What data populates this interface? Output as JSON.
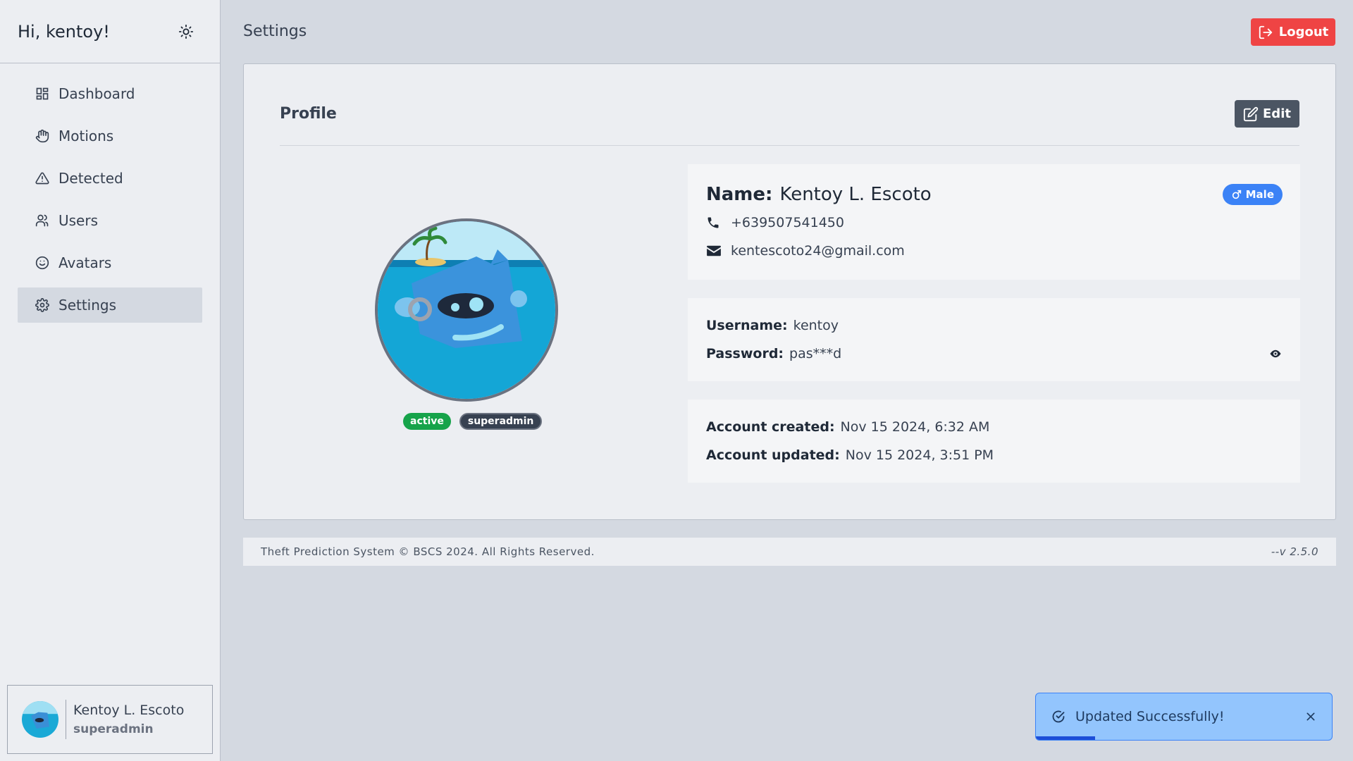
{
  "sidebar": {
    "greeting": "Hi, kentoy!",
    "items": [
      {
        "label": "Dashboard",
        "icon": "dashboard-icon"
      },
      {
        "label": "Motions",
        "icon": "hand-icon"
      },
      {
        "label": "Detected",
        "icon": "warning-icon"
      },
      {
        "label": "Users",
        "icon": "users-icon"
      },
      {
        "label": "Avatars",
        "icon": "smiley-icon"
      },
      {
        "label": "Settings",
        "icon": "gear-icon"
      }
    ],
    "active": "Settings",
    "user": {
      "name": "Kentoy L. Escoto",
      "role": "superadmin"
    }
  },
  "header": {
    "title": "Settings",
    "logout_label": "Logout"
  },
  "profile": {
    "title": "Profile",
    "edit_label": "Edit",
    "badges": {
      "status": "active",
      "role": "superadmin"
    },
    "name_label": "Name:",
    "name": "Kentoy L. Escoto",
    "gender": "Male",
    "phone": "+639507541450",
    "email": "kentescoto24@gmail.com",
    "username_label": "Username:",
    "username": "kentoy",
    "password_label": "Password:",
    "password": "pas***d",
    "created_label": "Account created:",
    "created": "Nov 15 2024, 6:32 AM",
    "updated_label": "Account updated:",
    "updated": "Nov 15 2024, 3:51 PM"
  },
  "footer": {
    "copyright": "Theft Prediction System © BSCS 2024. All Rights Reserved.",
    "version": "--v 2.5.0"
  },
  "toast": {
    "message": "Updated Successfully!",
    "progress": 0.2
  },
  "colors": {
    "danger": "#ef4444",
    "success": "#16a34a",
    "primary": "#3b82f6",
    "toast_bg": "#93c5fd"
  }
}
